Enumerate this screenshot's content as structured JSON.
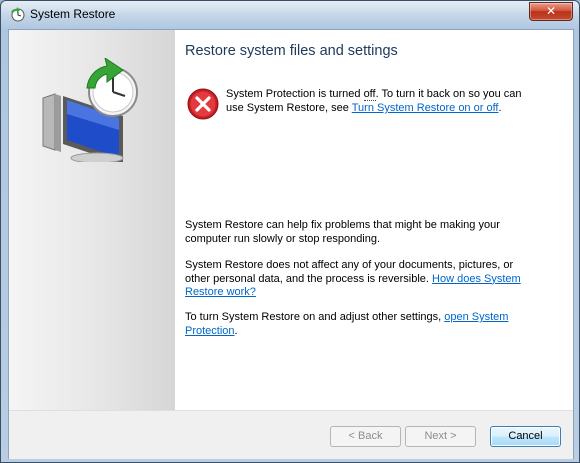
{
  "window": {
    "title": "System Restore",
    "title_icon": "system-restore-icon",
    "close_label": "✕"
  },
  "sidebar": {
    "art_icon": "system-restore-monitor-clock-icon"
  },
  "content": {
    "heading": "Restore system files and settings",
    "error": {
      "icon": "error-x-icon",
      "text_part1": "System Protection is turned ",
      "text_off": "off",
      "text_part2": ". To turn it back on so you can use System Restore, see ",
      "link": "Turn System Restore on or off",
      "text_end": "."
    },
    "para1": "System Restore can help fix problems that might be making your computer run slowly or stop responding.",
    "para2_text": "System Restore does not affect any of your documents, pictures, or other personal data, and the process is reversible. ",
    "para2_link": "How does System Restore work?",
    "para3_text": "To turn System Restore on and adjust other settings, ",
    "para3_link": "open System Protection",
    "para3_end": "."
  },
  "footer": {
    "back_label": "< Back",
    "next_label": "Next >",
    "cancel_label": "Cancel"
  },
  "colors": {
    "heading": "#1e395b",
    "link": "#0066cc",
    "error_red": "#d9262c"
  }
}
